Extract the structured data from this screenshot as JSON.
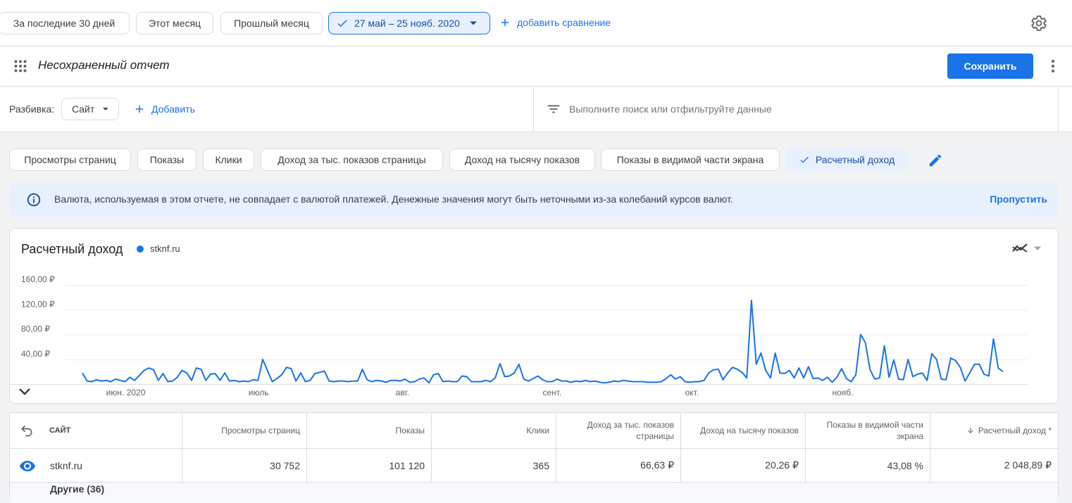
{
  "date_range": {
    "presets": [
      "За последние 30 дней",
      "Этот месяц",
      "Прошлый месяц"
    ],
    "selected_label": "27 май – 25 нояб. 2020",
    "add_comparison_label": "добавить сравнение"
  },
  "report": {
    "title": "Несохраненный отчет",
    "save_label": "Сохранить"
  },
  "breakdown": {
    "label": "Разбивка:",
    "selected": "Сайт",
    "add_label": "Добавить"
  },
  "search": {
    "placeholder": "Выполните поиск или отфильтруйте данные"
  },
  "metrics": [
    "Просмотры страниц",
    "Показы",
    "Клики",
    "Доход за тыс. показов страницы",
    "Доход на тысячу показов",
    "Показы в видимой части экрана",
    "Расчетный доход"
  ],
  "banner": {
    "text": "Валюта, используемая в этом отчете, не совпадает с валютой платежей. Денежные значения могут быть неточными из-за колебаний курсов валют.",
    "dismiss_label": "Пропустить"
  },
  "chart_data": {
    "type": "line",
    "title": "Расчетный доход",
    "legend_position": "top-left",
    "series": [
      {
        "name": "stknf.ru",
        "color": "#1a73e8",
        "values": [
          18,
          5,
          4,
          7,
          5,
          6,
          4,
          8,
          6,
          4,
          11,
          6,
          14,
          22,
          26,
          23,
          6,
          17,
          4,
          5,
          11,
          22,
          18,
          6,
          26,
          24,
          6,
          16,
          17,
          6,
          18,
          5,
          6,
          4,
          5,
          4,
          7,
          6,
          40,
          22,
          4,
          9,
          15,
          27,
          25,
          5,
          18,
          4,
          6,
          17,
          19,
          21,
          5,
          4,
          5,
          5,
          4,
          5,
          5,
          24,
          7,
          4,
          6,
          5,
          3,
          6,
          6,
          5,
          8,
          3,
          4,
          8,
          10,
          2,
          15,
          17,
          4,
          5,
          4,
          4,
          13,
          12,
          4,
          4,
          4,
          6,
          4,
          10,
          33,
          12,
          13,
          18,
          32,
          8,
          5,
          9,
          13,
          7,
          4,
          4,
          8,
          5,
          5,
          3,
          5,
          4,
          6,
          4,
          5,
          3,
          2,
          3,
          5,
          4,
          6,
          5,
          4,
          4,
          4,
          3,
          3,
          3,
          4,
          9,
          15,
          8,
          12,
          4,
          3,
          4,
          4,
          6,
          18,
          23,
          24,
          7,
          18,
          27,
          24,
          19,
          10,
          135,
          32,
          50,
          22,
          10,
          50,
          18,
          17,
          22,
          10,
          26,
          10,
          28,
          9,
          10,
          6,
          11,
          3,
          11,
          25,
          9,
          4,
          15,
          80,
          67,
          23,
          8,
          10,
          62,
          11,
          39,
          8,
          7,
          40,
          12,
          16,
          18,
          6,
          49,
          40,
          8,
          7,
          42,
          38,
          27,
          5,
          18,
          32,
          32,
          16,
          13,
          73,
          26,
          20
        ]
      }
    ],
    "x_tick_labels": [
      "июн. 2020",
      "июль",
      "авг.",
      "сент.",
      "окт.",
      "нояб."
    ],
    "y_tick_labels": [
      "40,00 ₽",
      "80,00 ₽",
      "120,00 ₽",
      "160,00 ₽"
    ],
    "y_ticks": [
      40,
      80,
      120,
      160
    ],
    "ylim": [
      0,
      160
    ],
    "grid": true
  },
  "table": {
    "columns": {
      "site": "САЙТ",
      "pageviews": "Просмотры страниц",
      "impressions": "Показы",
      "clicks": "Клики",
      "page_rpm": "Доход за тыс. показов страницы",
      "impression_rpm": "Доход на тысячу показов",
      "viewability": "Показы в видимой части экрана",
      "earnings": "Расчетный доход *"
    },
    "rows": [
      {
        "site": "stknf.ru",
        "pageviews": "30 752",
        "impressions": "101 120",
        "clicks": "365",
        "page_rpm": "66,63 ₽",
        "impression_rpm": "20,26 ₽",
        "viewability": "43,08 %",
        "earnings": "2 048,89 ₽"
      },
      {
        "site": "Другие (36)"
      }
    ]
  }
}
